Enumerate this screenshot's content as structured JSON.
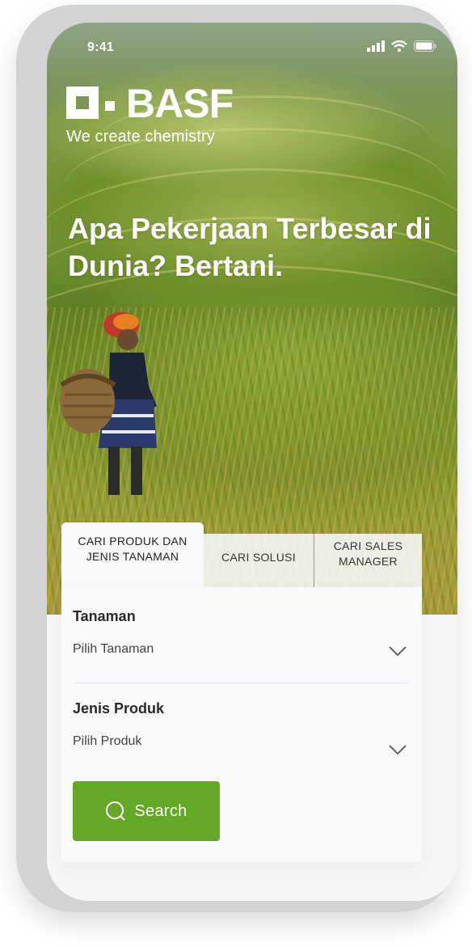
{
  "status_bar": {
    "time": "9:41"
  },
  "brand": {
    "name": "BASF",
    "tagline": "We create chemistry"
  },
  "hero": {
    "headline": "Apa Pekerjaan Terbesar di Dunia? Bertani."
  },
  "tabs": [
    {
      "label": "CARI PRODUK DAN JENIS TANAMAN",
      "active": true
    },
    {
      "label": "CARI SOLUSI",
      "active": false
    },
    {
      "label": "CARI SALES MANAGER",
      "active": false
    }
  ],
  "form": {
    "crop": {
      "label": "Tanaman",
      "value": "Pilih Tanaman"
    },
    "product_type": {
      "label": "Jenis Produk",
      "value": "Pilih Produk"
    },
    "search_label": "Search"
  },
  "colors": {
    "accent": "#63a925",
    "card": "#f8f9fb",
    "frame": "#d3d3d5"
  },
  "icons": [
    "signal-icon",
    "wifi-icon",
    "battery-icon",
    "chevron-down-icon",
    "search-icon"
  ]
}
